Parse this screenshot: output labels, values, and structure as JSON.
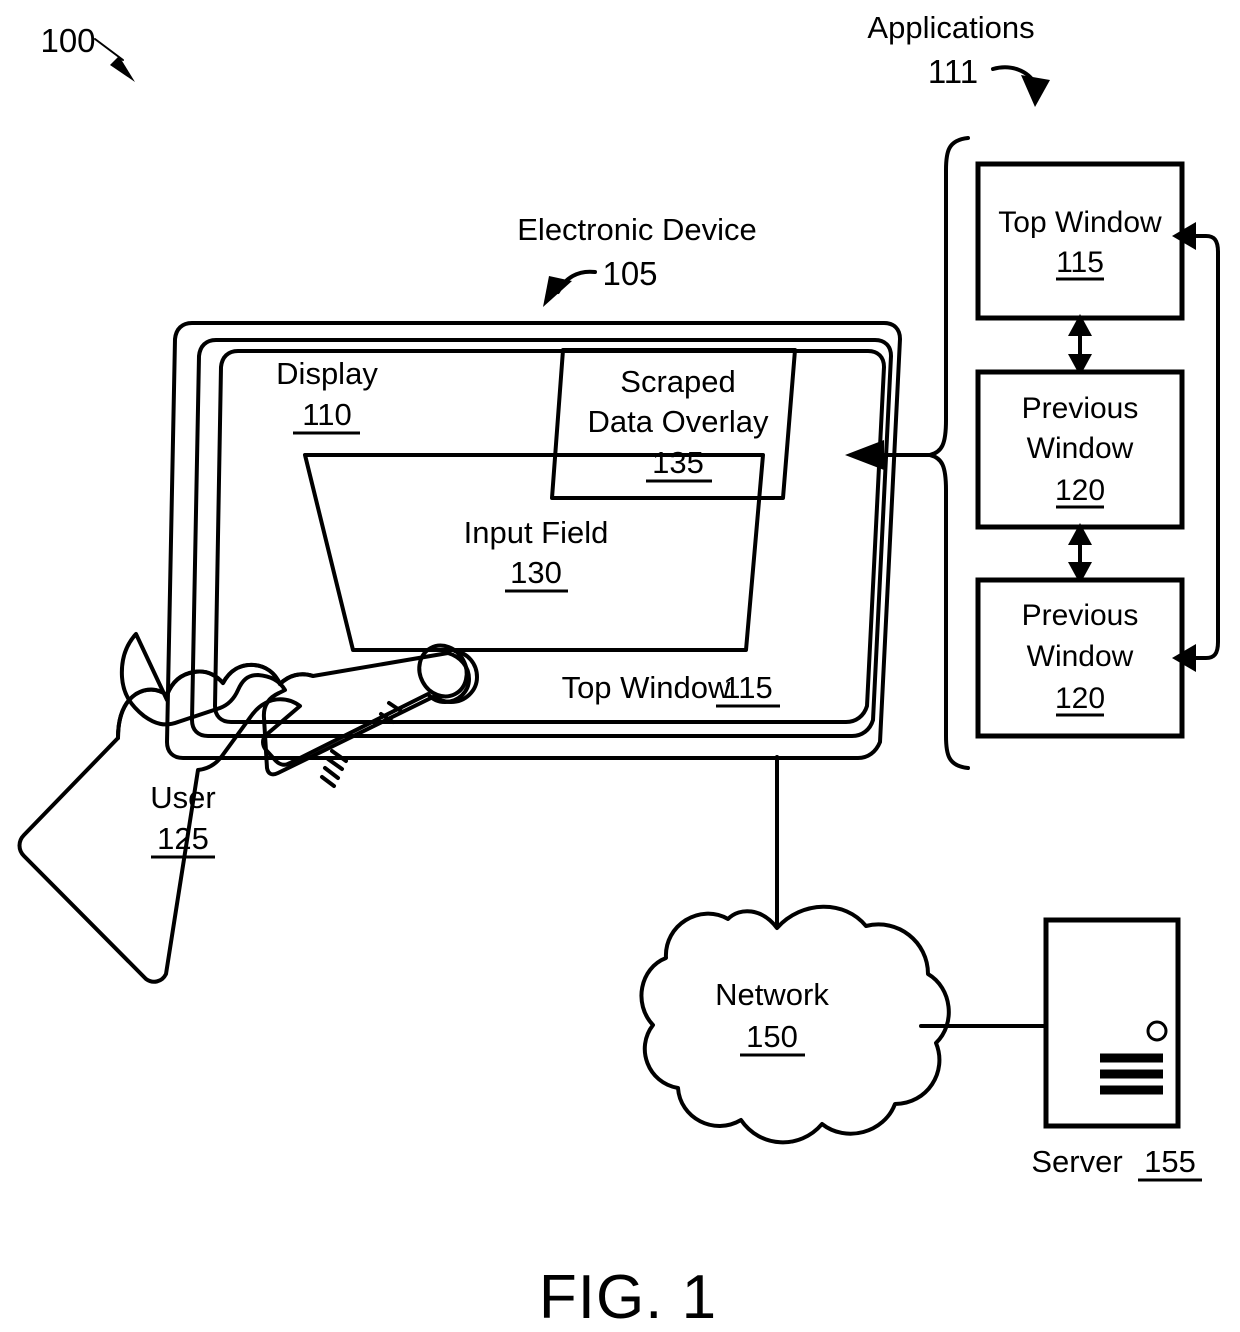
{
  "figure": {
    "caption": "FIG. 1",
    "system_ref": "100"
  },
  "applications": {
    "title": "Applications",
    "ref": "111",
    "windows": [
      {
        "line1": "Top Window",
        "line2": "",
        "ref": "115",
        "name": "top-window-box"
      },
      {
        "line1": "Previous",
        "line2": "Window",
        "ref": "120",
        "name": "previous-window-box-1"
      },
      {
        "line1": "Previous",
        "line2": "Window",
        "ref": "120",
        "name": "previous-window-box-2"
      }
    ]
  },
  "device": {
    "title": "Electronic Device",
    "ref": "105",
    "display": {
      "label": "Display",
      "ref": "110"
    },
    "overlay": {
      "line1": "Scraped",
      "line2": "Data Overlay",
      "ref": "135"
    },
    "input_field": {
      "label": "Input Field",
      "ref": "130"
    },
    "top_window": {
      "label": "Top Window",
      "ref": "115"
    }
  },
  "user": {
    "label": "User",
    "ref": "125"
  },
  "network": {
    "label": "Network",
    "ref": "150"
  },
  "server": {
    "label": "Server",
    "ref": "155"
  }
}
